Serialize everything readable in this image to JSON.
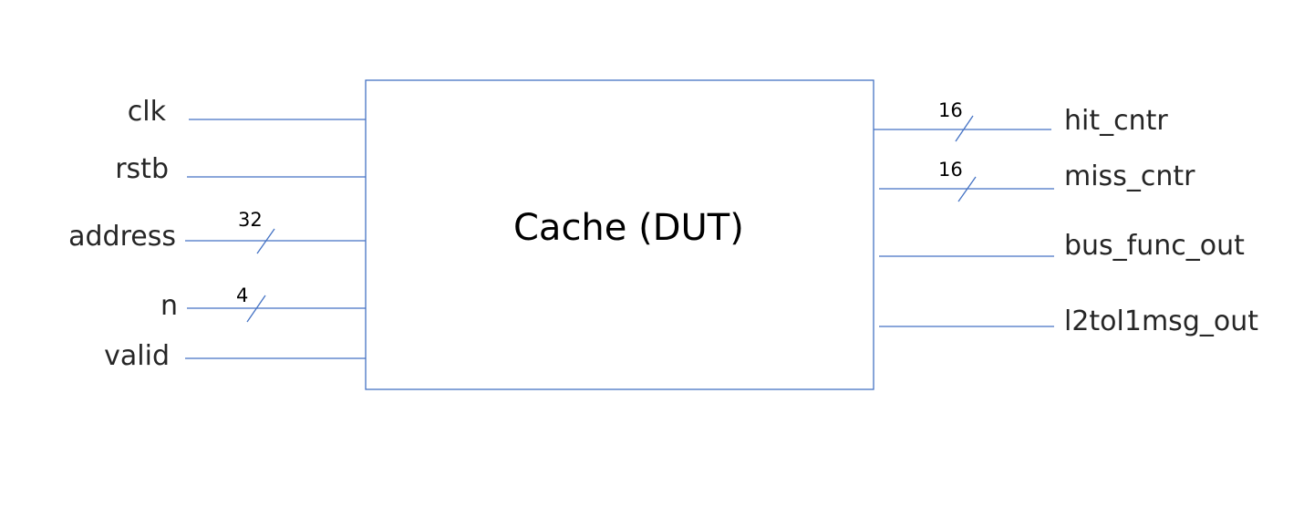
{
  "block": {
    "title": "Cache (DUT)"
  },
  "inputs": [
    {
      "name": "clk"
    },
    {
      "name": "rstb"
    },
    {
      "name": "address",
      "width": "32"
    },
    {
      "name": "n",
      "width": "4"
    },
    {
      "name": "valid"
    }
  ],
  "outputs": [
    {
      "name": "hit_cntr",
      "width": "16"
    },
    {
      "name": "miss_cntr",
      "width": "16"
    },
    {
      "name": "bus_func_out"
    },
    {
      "name": "l2tol1msg_out"
    }
  ],
  "colors": {
    "line": "#4472c4",
    "text": "#262626"
  }
}
